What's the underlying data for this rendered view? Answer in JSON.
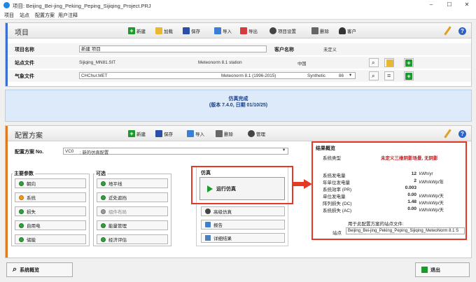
{
  "window": {
    "title": "项目: Beijing_Bei-jing_Peking_Peping_Sijiqing_Project.PRJ"
  },
  "menu": [
    "项目",
    "站点",
    "配置方案",
    "用户注释"
  ],
  "project": {
    "section_title": "项目",
    "toolbar": {
      "new": "新建",
      "load": "加载",
      "save": "保存",
      "import": "导入",
      "export": "导出",
      "settings": "项目设置",
      "delete": "删除",
      "client": "客户"
    },
    "name_label": "项目名称",
    "name_value": "新建 项目",
    "client_label": "客户名称",
    "client_value": "未定义",
    "site_label": "站点文件",
    "site_file": "Sijiqing_MN81.SIT",
    "site_source": "Meteonorm 8.1 station",
    "site_country": "中国",
    "meteo_label": "气象文件",
    "meteo_file": "CHChur.MET",
    "meteo_source": "Meteonorm 8.1 (1996-2015)",
    "meteo_type": "Synthetic",
    "meteo_size": "86"
  },
  "sim_banner": {
    "line1": "仿真完成",
    "line2": "(版本 7.4.0, 日期 01/10/25)"
  },
  "config": {
    "section_title": "配置方案",
    "toolbar": {
      "new": "新建",
      "save": "保存",
      "import": "导入",
      "delete": "删除",
      "manage": "管理"
    },
    "variant_label": "配置方案 No.",
    "variant_code": "VC0",
    "variant_name": ": 新的仿真配置",
    "main_params_label": "主要参数",
    "main_params": [
      "朝向",
      "系统",
      "损失",
      "自用电",
      "储能"
    ],
    "optional_label": "可选",
    "optional": [
      "地平线",
      "近处遮挡",
      "组件布局",
      "能量管理",
      "经济评估"
    ],
    "simulation_label": "仿真",
    "run_label": "运行仿真",
    "advanced_label": "高级仿真",
    "report_label": "报告",
    "details_label": "详细结果"
  },
  "results": {
    "title": "结果概览",
    "system_type_label": "系统类型",
    "system_type_value": "未定义三维阴影场景, 无阴影",
    "rows": [
      {
        "label": "系统发电量",
        "value": "12",
        "unit": "kWh/yr"
      },
      {
        "label": "年单位发电量",
        "value": "2",
        "unit": "kWh/kWp/年"
      },
      {
        "label": "系统效率 (PR)",
        "value": "0.003",
        "unit": ""
      },
      {
        "label": "单位发电量",
        "value": "0.00",
        "unit": "kWh/kWp/天"
      },
      {
        "label": "阵列损失 (DC)",
        "value": "1.48",
        "unit": "kWh/kWp/天"
      },
      {
        "label": "系统损失 (AC)",
        "value": "0.00",
        "unit": "kWh/kWp/天"
      }
    ],
    "site_note": "用于此配置方案的站点文件:",
    "site_label": "站点",
    "site_value": "Beijing_Bei-jing_Peking_Peping_Sijiqing_MeteoNorm 8.1 S"
  },
  "bottom": {
    "overview": "系统概览",
    "exit": "退出"
  }
}
